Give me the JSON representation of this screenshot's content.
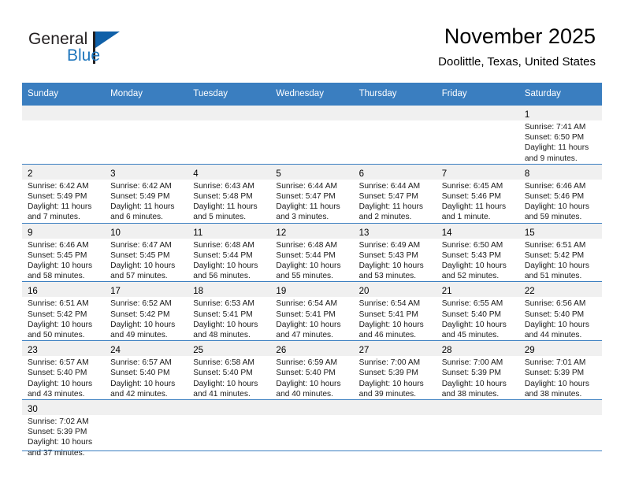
{
  "brand": {
    "name_part1": "General",
    "name_part2": "Blue",
    "flag_icon": "blue-flag-icon",
    "accent_color": "#1f76bc"
  },
  "header": {
    "title": "November 2025",
    "location": "Doolittle, Texas, United States",
    "header_bg_color": "#3a7ec0",
    "daynum_band_color": "#f0f0f0"
  },
  "calendar": {
    "weekday_headers": [
      "Sunday",
      "Monday",
      "Tuesday",
      "Wednesday",
      "Thursday",
      "Friday",
      "Saturday"
    ],
    "labels": {
      "sunrise": "Sunrise:",
      "sunset": "Sunset:",
      "daylight": "Daylight:"
    },
    "weeks": [
      [
        {
          "day": "",
          "empty": true
        },
        {
          "day": "",
          "empty": true
        },
        {
          "day": "",
          "empty": true
        },
        {
          "day": "",
          "empty": true
        },
        {
          "day": "",
          "empty": true
        },
        {
          "day": "",
          "empty": true
        },
        {
          "day": "1",
          "sunrise": "Sunrise: 7:41 AM",
          "sunset": "Sunset: 6:50 PM",
          "daylight1": "Daylight: 11 hours",
          "daylight2": "and 9 minutes."
        }
      ],
      [
        {
          "day": "2",
          "sunrise": "Sunrise: 6:42 AM",
          "sunset": "Sunset: 5:49 PM",
          "daylight1": "Daylight: 11 hours",
          "daylight2": "and 7 minutes."
        },
        {
          "day": "3",
          "sunrise": "Sunrise: 6:42 AM",
          "sunset": "Sunset: 5:49 PM",
          "daylight1": "Daylight: 11 hours",
          "daylight2": "and 6 minutes."
        },
        {
          "day": "4",
          "sunrise": "Sunrise: 6:43 AM",
          "sunset": "Sunset: 5:48 PM",
          "daylight1": "Daylight: 11 hours",
          "daylight2": "and 5 minutes."
        },
        {
          "day": "5",
          "sunrise": "Sunrise: 6:44 AM",
          "sunset": "Sunset: 5:47 PM",
          "daylight1": "Daylight: 11 hours",
          "daylight2": "and 3 minutes."
        },
        {
          "day": "6",
          "sunrise": "Sunrise: 6:44 AM",
          "sunset": "Sunset: 5:47 PM",
          "daylight1": "Daylight: 11 hours",
          "daylight2": "and 2 minutes."
        },
        {
          "day": "7",
          "sunrise": "Sunrise: 6:45 AM",
          "sunset": "Sunset: 5:46 PM",
          "daylight1": "Daylight: 11 hours",
          "daylight2": "and 1 minute."
        },
        {
          "day": "8",
          "sunrise": "Sunrise: 6:46 AM",
          "sunset": "Sunset: 5:46 PM",
          "daylight1": "Daylight: 10 hours",
          "daylight2": "and 59 minutes."
        }
      ],
      [
        {
          "day": "9",
          "sunrise": "Sunrise: 6:46 AM",
          "sunset": "Sunset: 5:45 PM",
          "daylight1": "Daylight: 10 hours",
          "daylight2": "and 58 minutes."
        },
        {
          "day": "10",
          "sunrise": "Sunrise: 6:47 AM",
          "sunset": "Sunset: 5:45 PM",
          "daylight1": "Daylight: 10 hours",
          "daylight2": "and 57 minutes."
        },
        {
          "day": "11",
          "sunrise": "Sunrise: 6:48 AM",
          "sunset": "Sunset: 5:44 PM",
          "daylight1": "Daylight: 10 hours",
          "daylight2": "and 56 minutes."
        },
        {
          "day": "12",
          "sunrise": "Sunrise: 6:48 AM",
          "sunset": "Sunset: 5:44 PM",
          "daylight1": "Daylight: 10 hours",
          "daylight2": "and 55 minutes."
        },
        {
          "day": "13",
          "sunrise": "Sunrise: 6:49 AM",
          "sunset": "Sunset: 5:43 PM",
          "daylight1": "Daylight: 10 hours",
          "daylight2": "and 53 minutes."
        },
        {
          "day": "14",
          "sunrise": "Sunrise: 6:50 AM",
          "sunset": "Sunset: 5:43 PM",
          "daylight1": "Daylight: 10 hours",
          "daylight2": "and 52 minutes."
        },
        {
          "day": "15",
          "sunrise": "Sunrise: 6:51 AM",
          "sunset": "Sunset: 5:42 PM",
          "daylight1": "Daylight: 10 hours",
          "daylight2": "and 51 minutes."
        }
      ],
      [
        {
          "day": "16",
          "sunrise": "Sunrise: 6:51 AM",
          "sunset": "Sunset: 5:42 PM",
          "daylight1": "Daylight: 10 hours",
          "daylight2": "and 50 minutes."
        },
        {
          "day": "17",
          "sunrise": "Sunrise: 6:52 AM",
          "sunset": "Sunset: 5:42 PM",
          "daylight1": "Daylight: 10 hours",
          "daylight2": "and 49 minutes."
        },
        {
          "day": "18",
          "sunrise": "Sunrise: 6:53 AM",
          "sunset": "Sunset: 5:41 PM",
          "daylight1": "Daylight: 10 hours",
          "daylight2": "and 48 minutes."
        },
        {
          "day": "19",
          "sunrise": "Sunrise: 6:54 AM",
          "sunset": "Sunset: 5:41 PM",
          "daylight1": "Daylight: 10 hours",
          "daylight2": "and 47 minutes."
        },
        {
          "day": "20",
          "sunrise": "Sunrise: 6:54 AM",
          "sunset": "Sunset: 5:41 PM",
          "daylight1": "Daylight: 10 hours",
          "daylight2": "and 46 minutes."
        },
        {
          "day": "21",
          "sunrise": "Sunrise: 6:55 AM",
          "sunset": "Sunset: 5:40 PM",
          "daylight1": "Daylight: 10 hours",
          "daylight2": "and 45 minutes."
        },
        {
          "day": "22",
          "sunrise": "Sunrise: 6:56 AM",
          "sunset": "Sunset: 5:40 PM",
          "daylight1": "Daylight: 10 hours",
          "daylight2": "and 44 minutes."
        }
      ],
      [
        {
          "day": "23",
          "sunrise": "Sunrise: 6:57 AM",
          "sunset": "Sunset: 5:40 PM",
          "daylight1": "Daylight: 10 hours",
          "daylight2": "and 43 minutes."
        },
        {
          "day": "24",
          "sunrise": "Sunrise: 6:57 AM",
          "sunset": "Sunset: 5:40 PM",
          "daylight1": "Daylight: 10 hours",
          "daylight2": "and 42 minutes."
        },
        {
          "day": "25",
          "sunrise": "Sunrise: 6:58 AM",
          "sunset": "Sunset: 5:40 PM",
          "daylight1": "Daylight: 10 hours",
          "daylight2": "and 41 minutes."
        },
        {
          "day": "26",
          "sunrise": "Sunrise: 6:59 AM",
          "sunset": "Sunset: 5:40 PM",
          "daylight1": "Daylight: 10 hours",
          "daylight2": "and 40 minutes."
        },
        {
          "day": "27",
          "sunrise": "Sunrise: 7:00 AM",
          "sunset": "Sunset: 5:39 PM",
          "daylight1": "Daylight: 10 hours",
          "daylight2": "and 39 minutes."
        },
        {
          "day": "28",
          "sunrise": "Sunrise: 7:00 AM",
          "sunset": "Sunset: 5:39 PM",
          "daylight1": "Daylight: 10 hours",
          "daylight2": "and 38 minutes."
        },
        {
          "day": "29",
          "sunrise": "Sunrise: 7:01 AM",
          "sunset": "Sunset: 5:39 PM",
          "daylight1": "Daylight: 10 hours",
          "daylight2": "and 38 minutes."
        }
      ],
      [
        {
          "day": "30",
          "sunrise": "Sunrise: 7:02 AM",
          "sunset": "Sunset: 5:39 PM",
          "daylight1": "Daylight: 10 hours",
          "daylight2": "and 37 minutes."
        },
        {
          "day": "",
          "empty": true
        },
        {
          "day": "",
          "empty": true
        },
        {
          "day": "",
          "empty": true
        },
        {
          "day": "",
          "empty": true
        },
        {
          "day": "",
          "empty": true
        },
        {
          "day": "",
          "empty": true
        }
      ]
    ]
  }
}
